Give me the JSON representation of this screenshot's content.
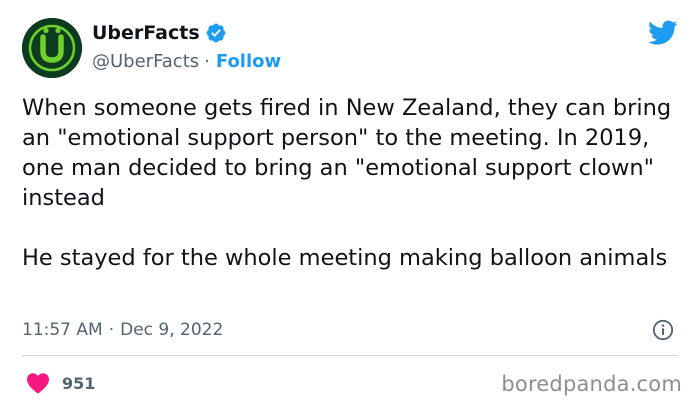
{
  "author": {
    "display_name": "UberFacts",
    "handle": "@UberFacts",
    "separator": "·",
    "follow_label": "Follow",
    "avatar_letter": "Ü",
    "avatar_bg_color": "#0d3b1f",
    "avatar_accent_color": "#6fd02c",
    "verified_icon": "verified-badge-icon"
  },
  "platform": {
    "logo_icon": "twitter-bird-icon",
    "brand_color": "#1d9bf0"
  },
  "tweet": {
    "paragraphs": [
      "When someone gets fired in New Zealand, they can bring an \"emotional support person\" to the meeting. In 2019, one man decided to bring an \"emotional support clown\" instead",
      "He stayed for the whole meeting making balloon animals"
    ],
    "time": "11:57 AM",
    "separator": "·",
    "date": "Dec 9, 2022",
    "info_icon": "info-icon"
  },
  "engagement": {
    "like_icon": "heart-icon",
    "like_count": "951",
    "like_color": "#f91880"
  },
  "watermark": "boredpanda.com"
}
